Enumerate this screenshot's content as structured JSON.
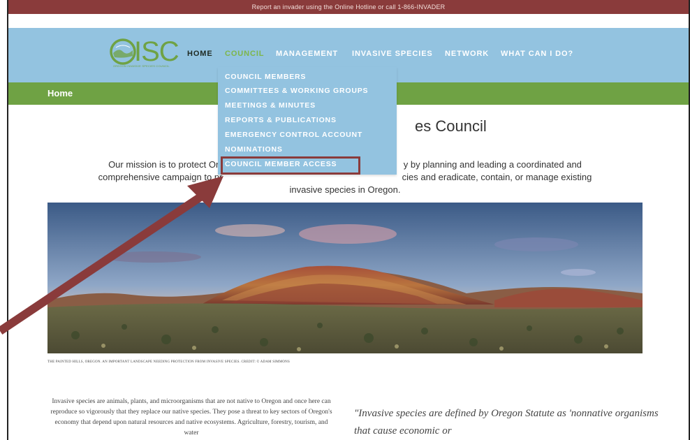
{
  "banner": {
    "text": "Report an invader using the Online Hotline or call 1-866-INVADER"
  },
  "logo": {
    "text": "ISC",
    "tagline": "OREGON INVASIVE SPECIES COUNCIL"
  },
  "nav": {
    "items": [
      {
        "label": "HOME"
      },
      {
        "label": "COUNCIL"
      },
      {
        "label": "MANAGEMENT"
      },
      {
        "label": "INVASIVE SPECIES"
      },
      {
        "label": "NETWORK"
      },
      {
        "label": "WHAT CAN I DO?"
      }
    ],
    "active": "COUNCIL"
  },
  "dropdown": {
    "items": [
      {
        "label": "COUNCIL MEMBERS"
      },
      {
        "label": "COMMITTEES & WORKING GROUPS"
      },
      {
        "label": "MEETINGS & MINUTES"
      },
      {
        "label": "REPORTS & PUBLICATIONS"
      },
      {
        "label": "EMERGENCY CONTROL ACCOUNT"
      },
      {
        "label": "NOMINATIONS"
      },
      {
        "label": "COUNCIL MEMBER ACCESS"
      }
    ],
    "highlighted": "COUNCIL MEMBER ACCESS"
  },
  "breadcrumb": {
    "label": "Home"
  },
  "page": {
    "title_visible": "es Council",
    "mission_line1": "Our mission is to protect Ore",
    "mission_line1b": "y by planning and leading a coordinated and",
    "mission_line2": "comprehensive campaign to pr",
    "mission_line2b": "cies and eradicate, contain, or manage existing",
    "mission_line3": "invasive species in Oregon.",
    "caption": "THE PAINTED HILLS, OREGON. AN IMPORTANT LANDSCAPE NEEDING PROTECTION FROM INVASIVE SPECIES. CREDIT: © ADAM SIMMONS",
    "body": "Invasive species are animals, plants, and microorganisms that are not native to Oregon and once here can reproduce so vigorously that they replace our native species. They pose a threat to key sectors of Oregon's economy that depend upon natural resources and native ecosystems. Agriculture, forestry, tourism, and water",
    "quote": "\"Invasive species are defined by Oregon Statute as 'nonnative organisms that cause economic or"
  },
  "colors": {
    "banner": "#8a3b3b",
    "nav": "#93c3e0",
    "greenbar": "#6fa244",
    "highlight": "#8a3b3b",
    "arrow": "#8a3b3b"
  }
}
